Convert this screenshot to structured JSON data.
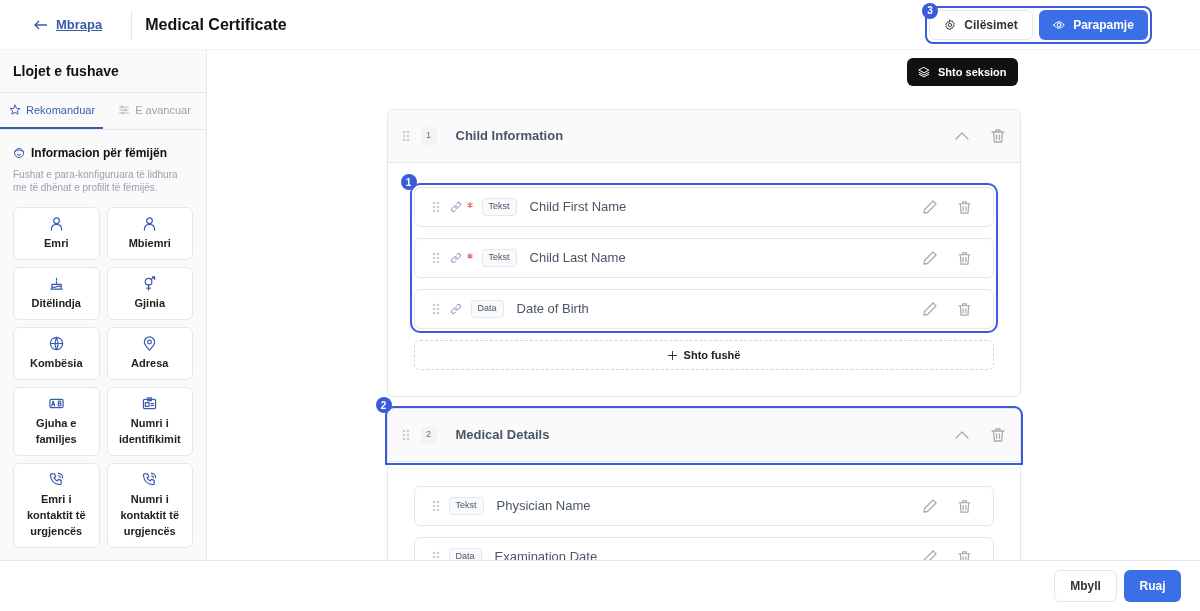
{
  "header": {
    "back_link": "Mbrapa",
    "title": "Medical Certificate",
    "highlight": "3",
    "actions": [
      {
        "label": "Cilësimet",
        "kind": "secondary"
      },
      {
        "label": "Parapamje",
        "kind": "primary"
      }
    ]
  },
  "sidebar": {
    "title": "Llojet e fushave",
    "tabs": [
      {
        "label": "Rekomanduar",
        "selected": true
      },
      {
        "label": "E avancuar",
        "selected": false
      }
    ],
    "group": {
      "title": "Informacion për fëmijën",
      "description": "Fushat e para-konfiguruara të lidhura me të dhënat e profilit të fëmijës.",
      "items": [
        {
          "label": "Emri"
        },
        {
          "label": "Mbiemri"
        },
        {
          "label": "Ditëlindja"
        },
        {
          "label": "Gjinia"
        },
        {
          "label": "Kombësia"
        },
        {
          "label": "Adresa"
        },
        {
          "label": "Gjuha e familjes"
        },
        {
          "label": "Numri i identifikimit"
        },
        {
          "label": "Emri i kontaktit të urgjencës"
        },
        {
          "label": "Numri i kontaktit të urgjencës"
        }
      ]
    }
  },
  "canvas": {
    "add_section": "Shto seksion",
    "sections": [
      {
        "number": "1",
        "title": "Child Information",
        "expanded": true,
        "fields_highlight": "1",
        "add_field": "Shto fushë",
        "fields": [
          {
            "type": "Tekst",
            "label": "Child First Name",
            "linked": true,
            "required": true
          },
          {
            "type": "Tekst",
            "label": "Child Last Name",
            "linked": true,
            "required": true
          },
          {
            "type": "Data",
            "label": "Date of Birth",
            "linked": true,
            "required": false
          }
        ]
      },
      {
        "number": "2",
        "title": "Medical Details",
        "expanded": true,
        "header_highlight": "2",
        "fields": [
          {
            "type": "Tekst",
            "label": "Physician Name",
            "linked": false,
            "required": false
          },
          {
            "type": "Data",
            "label": "Examination Date",
            "linked": false,
            "required": false
          }
        ]
      }
    ]
  },
  "footer": {
    "buttons": [
      {
        "label": "Mbyll",
        "kind": "secondary"
      },
      {
        "label": "Ruaj",
        "kind": "primary"
      }
    ]
  }
}
